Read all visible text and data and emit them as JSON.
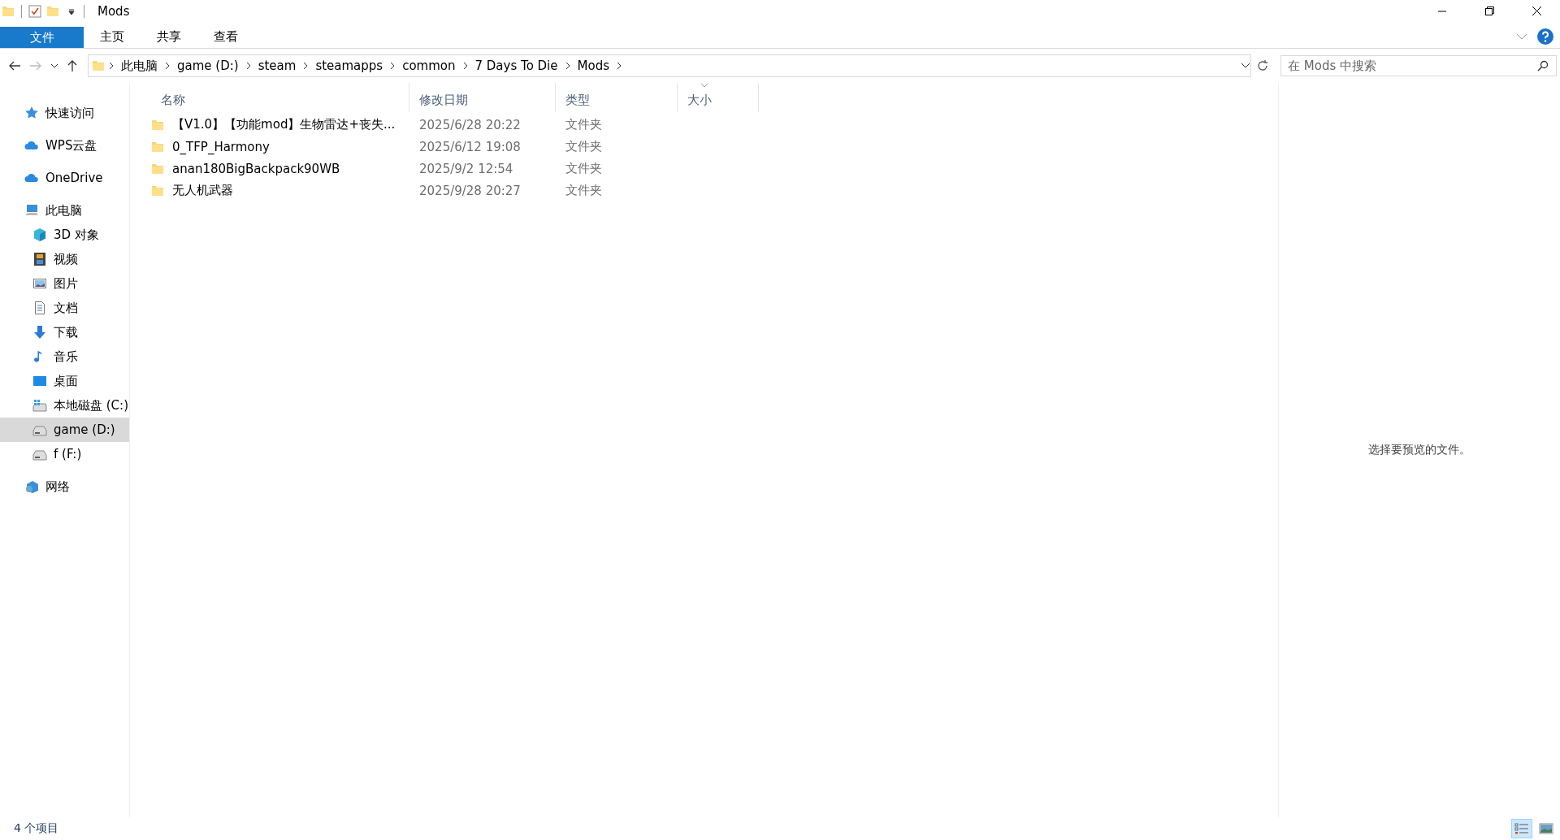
{
  "window": {
    "title": "Mods"
  },
  "ribbon_tabs": [
    {
      "label": "文件",
      "kind": "file"
    },
    {
      "label": "主页",
      "kind": "tab"
    },
    {
      "label": "共享",
      "kind": "tab"
    },
    {
      "label": "查看",
      "kind": "tab"
    }
  ],
  "breadcrumb": [
    "此电脑",
    "game (D:)",
    "steam",
    "steamapps",
    "common",
    "7 Days To Die",
    "Mods"
  ],
  "search": {
    "placeholder": "在 Mods 中搜索"
  },
  "sidebar": {
    "items": [
      {
        "label": "快速访问",
        "kind": "star",
        "selected": false
      },
      {
        "label": "WPS云盘",
        "kind": "cloud",
        "selected": false
      },
      {
        "label": "OneDrive",
        "kind": "cloud",
        "selected": false
      },
      {
        "label": "此电脑",
        "kind": "computer",
        "selected": false,
        "children": [
          {
            "label": "3D 对象",
            "kind": "cube",
            "selected": false
          },
          {
            "label": "视频",
            "kind": "film",
            "selected": false
          },
          {
            "label": "图片",
            "kind": "picture",
            "selected": false
          },
          {
            "label": "文档",
            "kind": "document",
            "selected": false
          },
          {
            "label": "下载",
            "kind": "download",
            "selected": false
          },
          {
            "label": "音乐",
            "kind": "music",
            "selected": false
          },
          {
            "label": "桌面",
            "kind": "desktop",
            "selected": false
          },
          {
            "label": "本地磁盘 (C:)",
            "kind": "system",
            "selected": false
          },
          {
            "label": "game (D:)",
            "kind": "drive",
            "selected": true
          },
          {
            "label": "f (F:)",
            "kind": "drive",
            "selected": false
          }
        ]
      },
      {
        "label": "网络",
        "kind": "network",
        "selected": false
      }
    ]
  },
  "table": {
    "columns": [
      "名称",
      "修改日期",
      "类型",
      "大小"
    ],
    "rows": [
      {
        "name": "【V1.0】【功能mod】生物雷达+丧失...",
        "date": "2025/6/28 20:22",
        "type": "文件夹"
      },
      {
        "name": "0_TFP_Harmony",
        "date": "2025/6/12 19:08",
        "type": "文件夹"
      },
      {
        "name": "anan180BigBackpack90WB",
        "date": "2025/9/2 12:54",
        "type": "文件夹"
      },
      {
        "name": "无人机武器",
        "date": "2025/9/28 20:27",
        "type": "文件夹"
      }
    ]
  },
  "preview": {
    "message": "选择要预览的文件。"
  },
  "status_bar": {
    "text": "4 个项目"
  },
  "view_buttons": [
    {
      "kind": "details",
      "selected": true
    },
    {
      "kind": "thumbnails",
      "selected": false
    }
  ]
}
